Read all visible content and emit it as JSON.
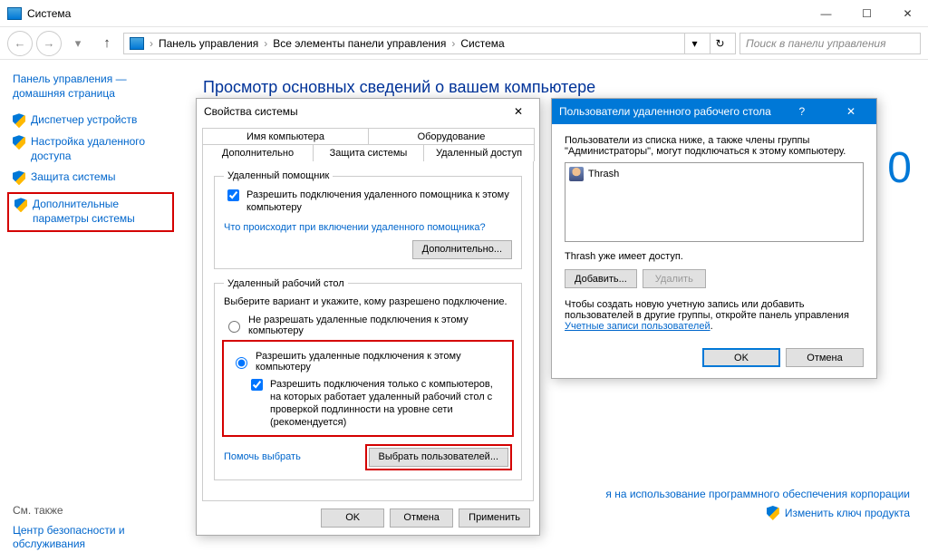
{
  "window": {
    "title": "Система"
  },
  "breadcrumb": {
    "cp": "Панель управления",
    "all": "Все элементы панели управления",
    "sys": "Система"
  },
  "search": {
    "placeholder": "Поиск в панели управления"
  },
  "sidebar": {
    "home": "Панель управления — домашняя страница",
    "links": {
      "devmgr": "Диспетчер устройств",
      "remote": "Настройка удаленного доступа",
      "protect": "Защита системы",
      "advanced": "Дополнительные параметры системы"
    },
    "seealso": "См. также",
    "sec": "Центр безопасности и обслуживания"
  },
  "content": {
    "heading": "Просмотр основных сведений о вашем компьютере",
    "terms": "я на использование программного обеспечения корпорации",
    "changekey": "Изменить ключ продукта",
    "tenlogo": "0"
  },
  "props": {
    "title": "Свойства системы",
    "tabs": {
      "name": "Имя компьютера",
      "hw": "Оборудование",
      "adv": "Дополнительно",
      "protect": "Защита системы",
      "remote": "Удаленный доступ"
    },
    "assist": {
      "legend": "Удаленный помощник",
      "chk": "Разрешить подключения удаленного помощника к этому компьютеру",
      "link": "Что происходит при включении удаленного помощника?",
      "advbtn": "Дополнительно..."
    },
    "rdp": {
      "legend": "Удаленный рабочий стол",
      "intro": "Выберите вариант и укажите, кому разрешено подключение.",
      "opt_no": "Не разрешать удаленные подключения к этому компьютеру",
      "opt_yes": "Разрешить удаленные подключения к этому компьютеру",
      "nla": "Разрешить подключения только с компьютеров, на которых работает удаленный рабочий стол с проверкой подлинности на уровне сети (рекомендуется)",
      "help": "Помочь выбрать",
      "select": "Выбрать пользователей..."
    },
    "ok": "OK",
    "cancel": "Отмена",
    "apply": "Применить"
  },
  "rdu": {
    "title": "Пользователи удаленного рабочего стола",
    "text1": "Пользователи из списка ниже, а также члены группы \"Администраторы\", могут подключаться к этому компьютеру.",
    "user": "Thrash",
    "has": "Thrash уже имеет доступ.",
    "add": "Добавить...",
    "del": "Удалить",
    "text2a": "Чтобы создать новую учетную запись или добавить пользователей в другие группы, откройте панель управления ",
    "link": "Учетные записи пользователей",
    "ok": "OK",
    "cancel": "Отмена"
  }
}
